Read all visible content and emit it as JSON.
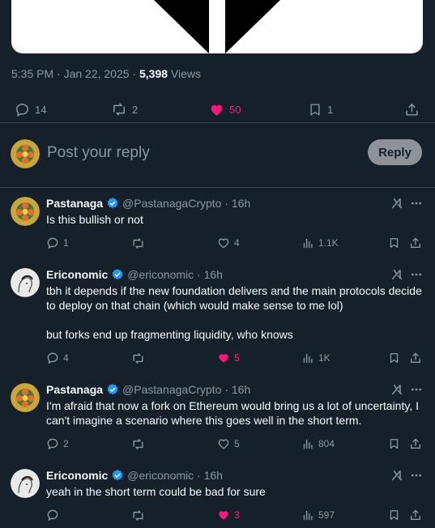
{
  "tweet": {
    "time": "5:35 PM · Jan 22, 2025 · ",
    "views_count": "5,398",
    "views_label": " Views",
    "actions": {
      "replies": "14",
      "reposts": "2",
      "likes": "50",
      "bookmarks": "1"
    }
  },
  "composer": {
    "placeholder": "Post your reply",
    "button_label": "Reply"
  },
  "colors": {
    "background": "#15202b",
    "like_pink": "#f91880",
    "verified_blue": "#1d9bf0",
    "muted": "#8b98a5"
  },
  "replies": [
    {
      "name": "Pastanaga",
      "handle": "@PastanagaCrypto · 16h",
      "text": "Is this bullish or not",
      "replies": "1",
      "reposts": "",
      "likes": "4",
      "liked": false,
      "views": "1.1K",
      "avatar": "flower-avatar"
    },
    {
      "name": "Ericonomic",
      "handle": "@ericonomic · 16h",
      "text": "tbh it depends if the new foundation delivers and the main protocols decide to deploy on that chain (which would make sense to me lol)",
      "text2": "but forks end up fragmenting liquidity, who knows",
      "replies": "4",
      "reposts": "",
      "likes": "5",
      "liked": true,
      "views": "1K",
      "avatar": "sketch-avatar"
    },
    {
      "name": "Pastanaga",
      "handle": "@PastanagaCrypto · 16h",
      "text": "I'm afraid that now a fork on Ethereum would bring us a lot of uncertainty, I can't imagine a scenario where this goes well in the short term.",
      "replies": "2",
      "reposts": "",
      "likes": "5",
      "liked": false,
      "views": "804",
      "avatar": "flower-avatar"
    },
    {
      "name": "Ericonomic",
      "handle": "@ericonomic · 16h",
      "text": "yeah in the short term could be bad for sure",
      "replies": "",
      "reposts": "",
      "likes": "3",
      "liked": true,
      "views": "597",
      "avatar": "sketch-avatar"
    }
  ]
}
